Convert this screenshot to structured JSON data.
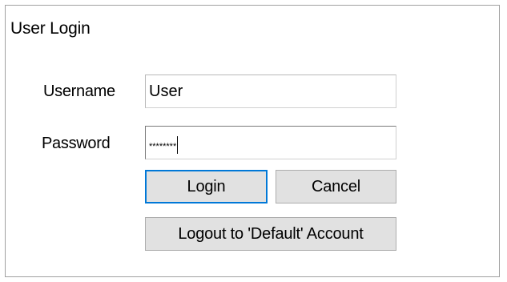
{
  "dialog": {
    "title": "User Login"
  },
  "form": {
    "username_label": "Username",
    "username_value": "User",
    "password_label": "Password",
    "password_value": "********"
  },
  "buttons": {
    "login": "Login",
    "cancel": "Cancel",
    "logout": "Logout to 'Default' Account"
  },
  "colors": {
    "focus_border": "#0078d7",
    "button_face": "#e1e1e1",
    "frame_border": "#a0a0a0"
  }
}
